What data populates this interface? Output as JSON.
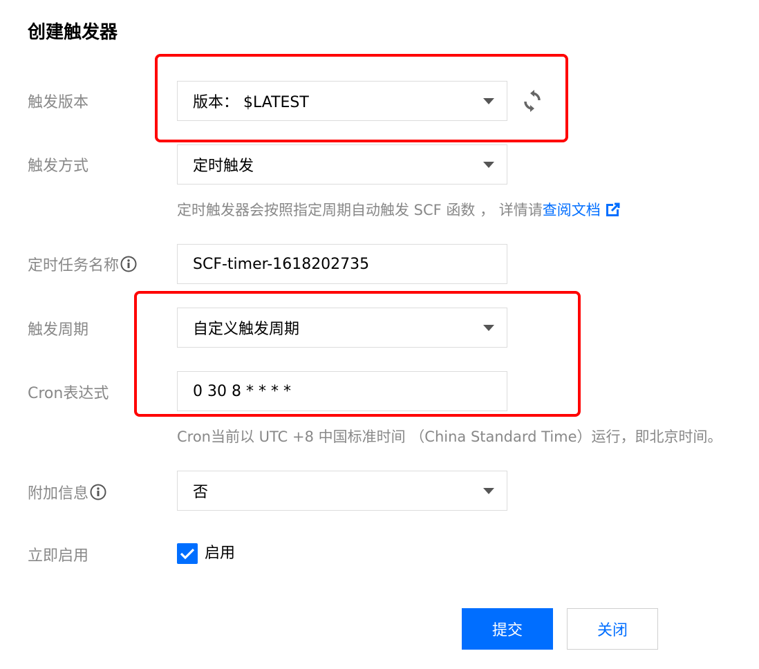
{
  "dialog": {
    "title": "创建触发器"
  },
  "form": {
    "version": {
      "label": "触发版本",
      "value": "版本： $LATEST"
    },
    "method": {
      "label": "触发方式",
      "value": "定时触发",
      "hint_text": "定时触发器会按照指定周期自动触发 SCF 函数 ， 详情请",
      "hint_link": "查阅文档"
    },
    "task_name": {
      "label": "定时任务名称",
      "value": "SCF-timer-1618202735"
    },
    "period": {
      "label": "触发周期",
      "value": "自定义触发周期"
    },
    "cron": {
      "label": "Cron表达式",
      "value": "0 30 8 * * * *",
      "hint": "Cron当前以 UTC +8 中国标准时间 （China Standard Time）运行，即北京时间。"
    },
    "extra": {
      "label": "附加信息",
      "value": "否"
    },
    "enable": {
      "label": "立即启用",
      "checkbox_label": "启用",
      "checked": true
    }
  },
  "actions": {
    "submit": "提交",
    "close": "关闭"
  },
  "colors": {
    "accent": "#006eff",
    "highlight": "#ff0000"
  },
  "icons": [
    "info-icon",
    "refresh-icon",
    "external-link-icon",
    "check-icon",
    "chevron-down-icon"
  ]
}
